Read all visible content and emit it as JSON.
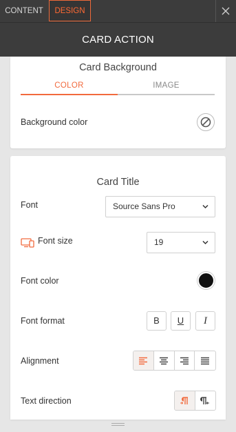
{
  "tabs": {
    "content": "CONTENT",
    "design": "DESIGN"
  },
  "header": {
    "title": "CARD ACTION"
  },
  "background_section": {
    "title": "Card Background",
    "subtabs": {
      "color": "COLOR",
      "image": "IMAGE"
    },
    "background_color_label": "Background color"
  },
  "title_section": {
    "title": "Card Title",
    "font_label": "Font",
    "font_value": "Source Sans Pro",
    "font_size_label": "Font size",
    "font_size_value": "19",
    "font_color_label": "Font color",
    "font_color_value": "#111111",
    "font_format_label": "Font format",
    "format_buttons": {
      "bold": "B",
      "underline": "U",
      "italic": "I"
    },
    "alignment_label": "Alignment",
    "text_direction_label": "Text direction"
  },
  "colors": {
    "accent": "#f26a3d",
    "bar": "#3c3c3c",
    "panel_bg": "#e6e6e6"
  }
}
